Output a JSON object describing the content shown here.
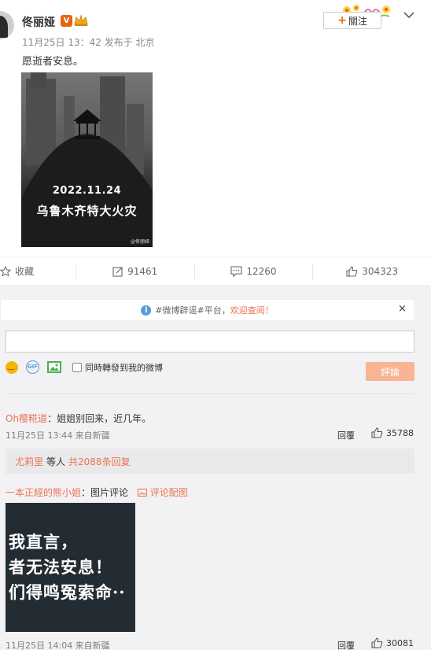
{
  "post": {
    "author": "佟丽娅",
    "verified_badge": "V",
    "time": "11月25日 13：42",
    "source": "发布于 北京",
    "text": "愿逝者安息。",
    "follow_label": "關注",
    "image": {
      "date_text": "2022.11.24",
      "caption": "乌鲁木齐特大火灾",
      "watermark": "@佟丽娅"
    }
  },
  "actions": {
    "favorite_label": "收藏",
    "repost_count": "91461",
    "comment_count": "12260",
    "like_count": "304323"
  },
  "comment_section": {
    "rumor_notice_tag": "#微博辟谣#平台，",
    "rumor_notice_welcome": "欢迎查阅！",
    "close_glyph": "×",
    "repost_checkbox_label": "同時轉發到我的微博",
    "submit_label": "評論",
    "reply_label": "回覆"
  },
  "comments": [
    {
      "user": "Oh樱糀道",
      "text": "：姐姐别回来，近几年。",
      "time": "11月25日 13:44 来自新疆",
      "likes": "35788",
      "sub_reply_user": "尤莉里",
      "sub_reply_mid": "等人",
      "sub_reply_count": "共2088条回复"
    },
    {
      "user": "一本正經的熊小姐",
      "text": "：图片评论",
      "pic_link": "评论配图",
      "image_lines": [
        "我直言，",
        "者无法安息！",
        "们得鸣冤索命··"
      ],
      "time": "11月25日 14:04 来自新疆",
      "likes": "30081"
    }
  ],
  "colors": {
    "accent": "#eb7350",
    "submit_disabled": "#f8b493",
    "background_gray": "#f2f2f5",
    "verified": "#e8640c"
  },
  "icons": [
    "star-icon",
    "repost-icon",
    "comment-icon",
    "thumbs-up-icon",
    "info-icon",
    "emoji-icon",
    "gif-icon",
    "picture-icon",
    "chevron-down-icon"
  ]
}
